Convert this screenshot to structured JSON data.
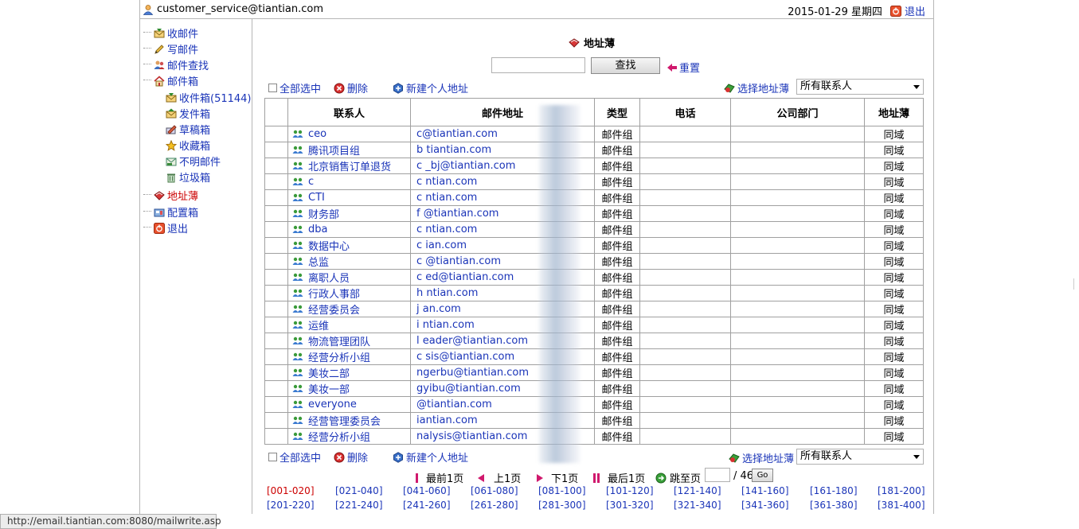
{
  "header": {
    "user_email": "customer_service@tiantian.com",
    "date": "2015-01-29 星期四",
    "logout": "退出"
  },
  "sidebar": {
    "items": [
      {
        "label": "收邮件",
        "icon": "inbox-envelope-icon"
      },
      {
        "label": "写邮件",
        "icon": "pencil-icon"
      },
      {
        "label": "邮件查找",
        "icon": "people-search-icon"
      },
      {
        "label": "邮件箱",
        "icon": "house-icon"
      },
      {
        "label": "收件箱(51144)",
        "icon": "inbox-envelope-icon"
      },
      {
        "label": "发件箱",
        "icon": "outbox-icon"
      },
      {
        "label": "草稿箱",
        "icon": "draft-icon"
      },
      {
        "label": "收藏箱",
        "icon": "star-icon"
      },
      {
        "label": "不明邮件",
        "icon": "unknown-mail-icon"
      },
      {
        "label": "垃圾箱",
        "icon": "trash-icon"
      },
      {
        "label": "地址薄",
        "icon": "address-book-icon"
      },
      {
        "label": "配置箱",
        "icon": "config-icon"
      },
      {
        "label": "退出",
        "icon": "exit-icon"
      }
    ]
  },
  "main": {
    "title": "地址薄",
    "search_button": "查找",
    "reset": "重置",
    "toolbar": {
      "select_all": "全部选中",
      "delete": "删除",
      "new_address": "新建个人地址",
      "choose_book": "选择地址薄",
      "book_value": "所有联系人"
    },
    "columns": [
      "联系人",
      "邮件地址",
      "类型",
      "电话",
      "公司部门",
      "地址薄"
    ],
    "rows": [
      {
        "name": "ceo",
        "email": "c@tiantian.com",
        "type": "邮件组",
        "book": "同域"
      },
      {
        "name": "腾讯项目组",
        "email": "b  tiantian.com",
        "type": "邮件组",
        "book": "同域"
      },
      {
        "name": "北京销售订单退货",
        "email": "c  _bj@tiantian.com",
        "type": "邮件组",
        "book": "同域"
      },
      {
        "name": "c",
        "email": "c  ntian.com",
        "type": "邮件组",
        "book": "同域"
      },
      {
        "name": "CTI",
        "email": "c  ntian.com",
        "type": "邮件组",
        "book": "同域"
      },
      {
        "name": "财务部",
        "email": "f  @tiantian.com",
        "type": "邮件组",
        "book": "同域"
      },
      {
        "name": "dba",
        "email": "c  ntian.com",
        "type": "邮件组",
        "book": "同域"
      },
      {
        "name": "数据中心",
        "email": "c  ian.com",
        "type": "邮件组",
        "book": "同域"
      },
      {
        "name": "总监",
        "email": "c  @tiantian.com",
        "type": "邮件组",
        "book": "同域"
      },
      {
        "name": "离职人员",
        "email": "c  ed@tiantian.com",
        "type": "邮件组",
        "book": "同域"
      },
      {
        "name": "行政人事部",
        "email": "h  ntian.com",
        "type": "邮件组",
        "book": "同域"
      },
      {
        "name": "经营委员会",
        "email": "j  an.com",
        "type": "邮件组",
        "book": "同域"
      },
      {
        "name": "运维",
        "email": "i  ntian.com",
        "type": "邮件组",
        "book": "同域"
      },
      {
        "name": "物流管理团队",
        "email": "l  eader@tiantian.com",
        "type": "邮件组",
        "book": "同域"
      },
      {
        "name": "经营分析小组",
        "email": "c  sis@tiantian.com",
        "type": "邮件组",
        "book": "同域"
      },
      {
        "name": "美妆二部",
        "email": "  ngerbu@tiantian.com",
        "type": "邮件组",
        "book": "同域"
      },
      {
        "name": "美妆一部",
        "email": "  gyibu@tiantian.com",
        "type": "邮件组",
        "book": "同域"
      },
      {
        "name": "everyone",
        "email": "  @tiantian.com",
        "type": "邮件组",
        "book": "同域"
      },
      {
        "name": "经营管理委员会",
        "email": "  iantian.com",
        "type": "邮件组",
        "book": "同域"
      },
      {
        "name": "经营分析小组",
        "email": "  nalysis@tiantian.com",
        "type": "邮件组",
        "book": "同域"
      }
    ],
    "pager": {
      "first": "最前1页",
      "prev": "上1页",
      "next": "下1页",
      "last": "最后1页",
      "jump": "跳至页",
      "total": "/ 46",
      "go": "Go",
      "pages": [
        "[001-020]",
        "[021-040]",
        "[041-060]",
        "[061-080]",
        "[081-100]",
        "[101-120]",
        "[121-140]",
        "[141-160]",
        "[161-180]",
        "[181-200]",
        "[201-220]",
        "[221-240]",
        "[241-260]",
        "[261-280]",
        "[281-300]",
        "[301-320]",
        "[321-340]",
        "[341-360]",
        "[361-380]",
        "[381-400]"
      ]
    }
  },
  "status_bar": "http://email.tiantian.com:8080/mailwrite.asp",
  "colors": {
    "link": "#1a34b8",
    "active": "#cc0000",
    "accent": "#d0196d",
    "border": "#a0a0a0"
  }
}
